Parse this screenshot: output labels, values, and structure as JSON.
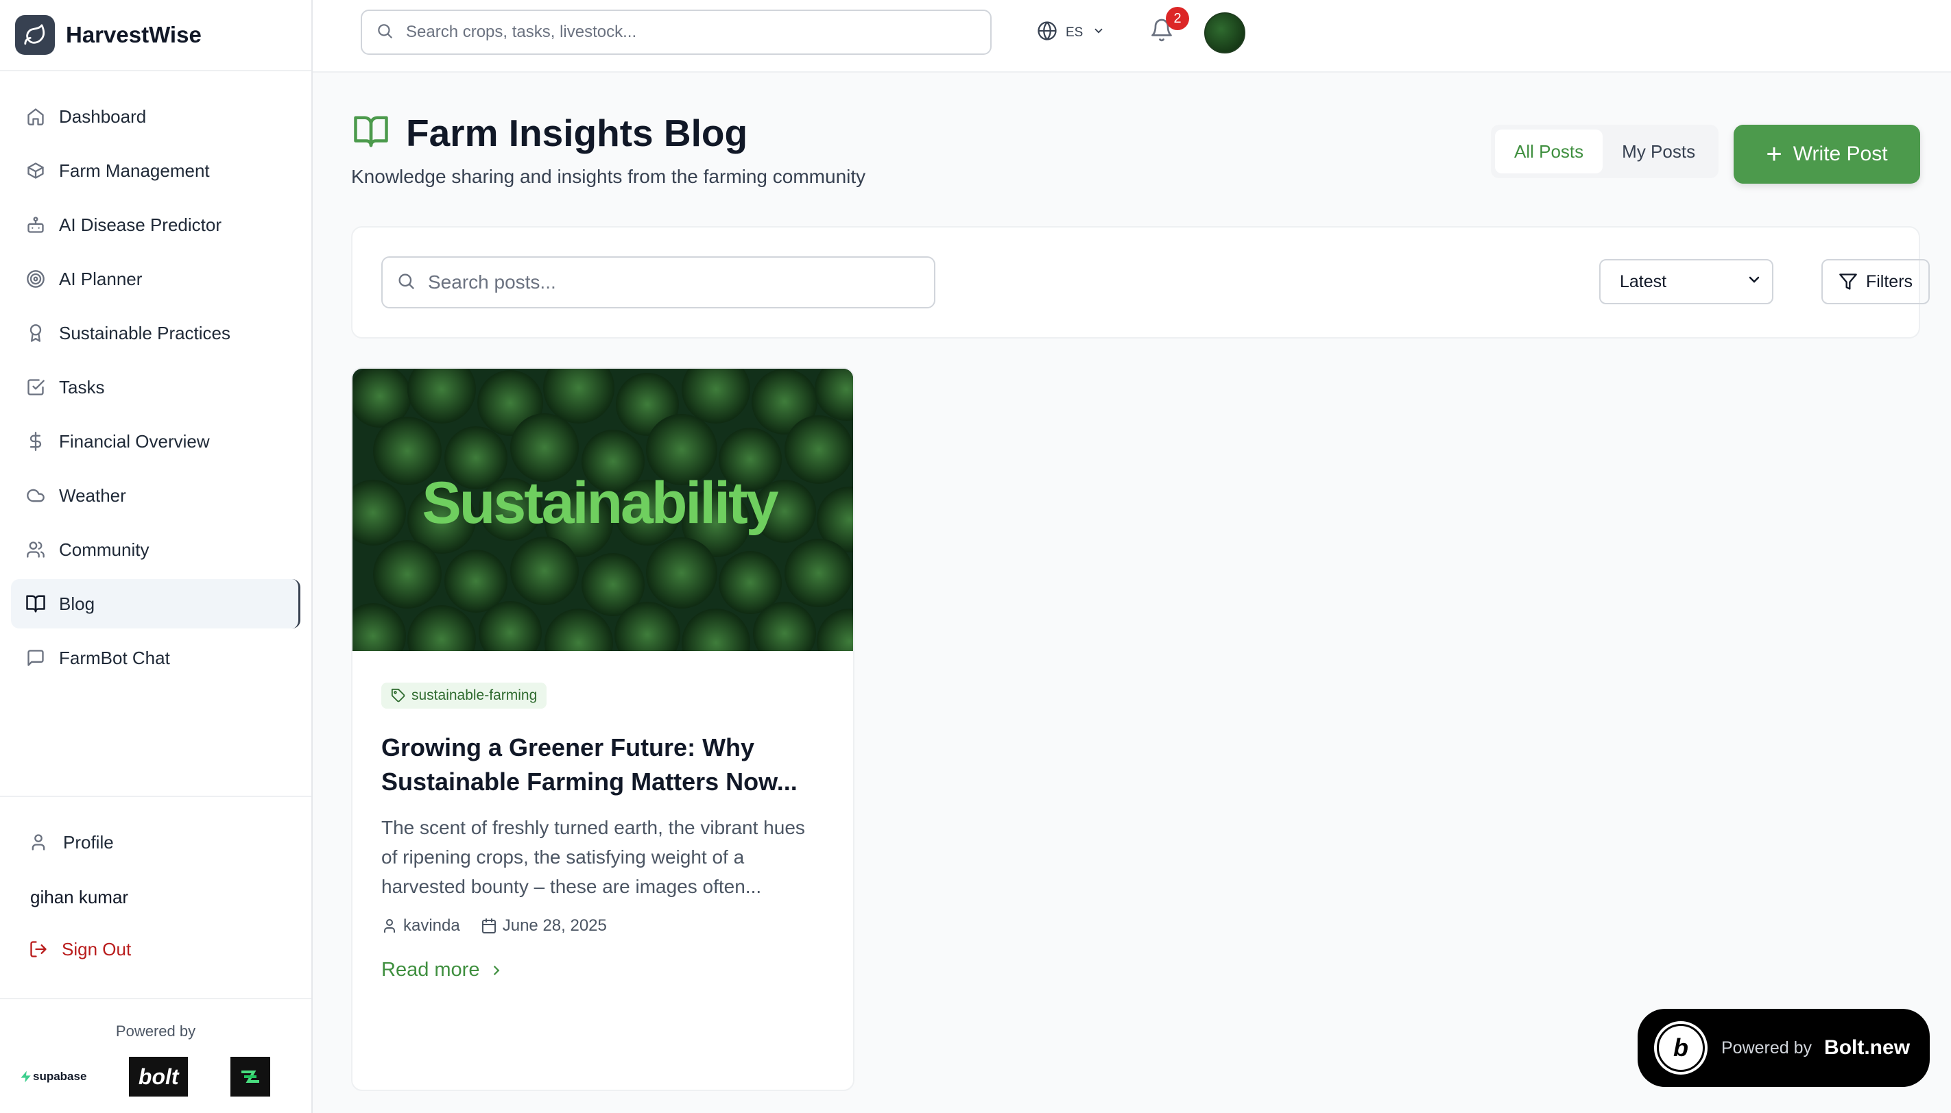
{
  "brand": {
    "name": "HarvestWise"
  },
  "sidebar": {
    "items": [
      {
        "label": "Dashboard",
        "icon": "home-icon"
      },
      {
        "label": "Farm Management",
        "icon": "box-icon"
      },
      {
        "label": "AI Disease Predictor",
        "icon": "bot-icon"
      },
      {
        "label": "AI Planner",
        "icon": "target-icon"
      },
      {
        "label": "Sustainable Practices",
        "icon": "award-icon"
      },
      {
        "label": "Tasks",
        "icon": "check-square-icon"
      },
      {
        "label": "Financial Overview",
        "icon": "dollar-icon"
      },
      {
        "label": "Weather",
        "icon": "cloud-icon"
      },
      {
        "label": "Community",
        "icon": "users-icon"
      },
      {
        "label": "Blog",
        "icon": "book-icon",
        "active": true
      },
      {
        "label": "FarmBot Chat",
        "icon": "message-icon"
      }
    ],
    "profile_label": "Profile",
    "user_name": "gihan kumar",
    "signout_label": "Sign Out",
    "powered_by": "Powered by",
    "logos": {
      "supabase": "supabase",
      "bolt": "bolt"
    }
  },
  "topbar": {
    "search_placeholder": "Search crops, tasks, livestock...",
    "language": "ES",
    "notification_count": "2"
  },
  "page": {
    "title": "Farm Insights Blog",
    "subtitle": "Knowledge sharing and insights from the farming community",
    "tabs": [
      {
        "label": "All Posts",
        "active": true
      },
      {
        "label": "My Posts",
        "active": false
      }
    ],
    "write_button": "Write Post",
    "post_search_placeholder": "Search posts...",
    "sort_selected": "Latest",
    "filters_label": "Filters"
  },
  "posts": [
    {
      "image_text": "Sustainability",
      "tag": "sustainable-farming",
      "title": "Growing a Greener Future: Why Sustainable Farming Matters Now...",
      "excerpt": "The scent of freshly turned earth, the vibrant hues of ripening crops, the satisfying weight of a harvested bounty – these are images often...",
      "author": "kavinda",
      "date": "June 28, 2025",
      "read_more": "Read more"
    }
  ],
  "bolt_badge": {
    "powered": "Powered by",
    "name": "Bolt.new",
    "letter": "b"
  },
  "colors": {
    "accent": "#4c9a4c",
    "accent_text": "#3f8f3f",
    "danger": "#dc2626",
    "sidebar_active_bg": "#f1f5f9"
  }
}
